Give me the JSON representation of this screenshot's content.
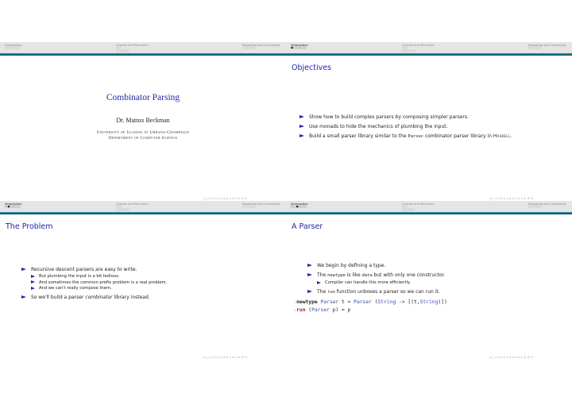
{
  "headline": {
    "sections": [
      {
        "label": "Introduction",
        "dots": [
          "○○○○○○"
        ]
      },
      {
        "label": "Choices and Recursion",
        "dots": [
          "○○",
          "○○○○○"
        ]
      },
      {
        "label": "Repeating and Composing",
        "dots": [
          "○○○○○"
        ]
      }
    ]
  },
  "slides": [
    {
      "headline_dots_intro": "○○○○○○",
      "title": "Combinator Parsing",
      "author": "Dr. Mattox Beckman",
      "institution_line1": "University of Illinois at Urbana-Champaign",
      "institution_line2": "Department of Computer Science"
    },
    {
      "headline_dots_intro": "●○○○○○",
      "frametitle": "Objectives",
      "items": [
        "Show how to build complex parsers by composing simpler parsers.",
        "Use monads to hide the mechanics of plumbing the input."
      ],
      "item3_pre": "Build a small parser library similar to the ",
      "item3_code": "Parsec",
      "item3_mid": " combinator parser library in ",
      "item3_sc": "Haskell",
      "item3_post": "."
    },
    {
      "headline_dots_intro": "○●○○○○",
      "frametitle": "The Problem",
      "item1": "Recursive descent parsers are easy to write.",
      "subitems": [
        "But plumbing the input is a bit tedious.",
        "And sometimes the common prefix problem is a real problem.",
        "And we can't really compose them."
      ],
      "item2_pre": "So we'll build a parser ",
      "item2_em": "combinator",
      "item2_post": " library instead."
    },
    {
      "headline_dots_intro": "○○●○○○",
      "frametitle": "A Parser",
      "item1": "We begin by defining a type.",
      "item2_pre": "The ",
      "item2_code1": "newtype",
      "item2_mid": " is like ",
      "item2_code2": "data",
      "item2_post": " but with only one constructor.",
      "subitem": "Compiler can handle this more efficiently.",
      "item3_pre": "The ",
      "item3_code": "run",
      "item3_post": " function unboxes a parser so we can run it.",
      "code": {
        "line1_no": "1",
        "line2_no": "2",
        "l1_kw": "newtype",
        "l1_ty1": "Parser",
        "l1_t": " t = ",
        "l1_ty2": "Parser",
        "l1_open": " (",
        "l1_ty3": "String",
        "l1_arrow": " -> [(t,",
        "l1_ty4": "String",
        "l1_close": ")])",
        "l2_fn": "run",
        "l2_open": " (",
        "l2_ty": "Parser",
        "l2_rest": " p) = p"
      }
    }
  ],
  "nav_symbols": "◂ □ ▸ ◂ ⊡ ▸ ◂ ≣ ▸ ◂ ≣ ▸   ≣   ↺⌕↻"
}
